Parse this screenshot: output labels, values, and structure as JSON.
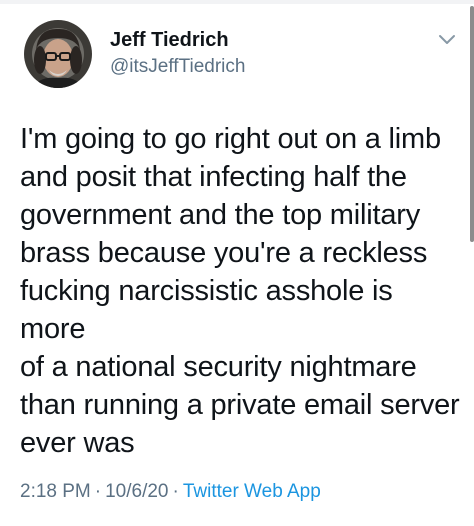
{
  "tweet": {
    "author": {
      "display_name": "Jeff Tiedrich",
      "handle": "@itsJeffTiedrich",
      "avatar_icon": "profile-photo"
    },
    "menu_icon": "chevron-down-icon",
    "text": "I'm going to go right out on a limb\nand posit that infecting half the\ngovernment and the top military\nbrass because you're a reckless\nfucking narcissistic asshole is more\nof a national security nightmare\nthan running a private email server\never was",
    "time": "2:18 PM",
    "separator": "·",
    "date": "10/6/20",
    "source": "Twitter Web App"
  },
  "colors": {
    "text": "#0f1419",
    "secondary": "#5b7083",
    "link": "#1b95e0"
  }
}
